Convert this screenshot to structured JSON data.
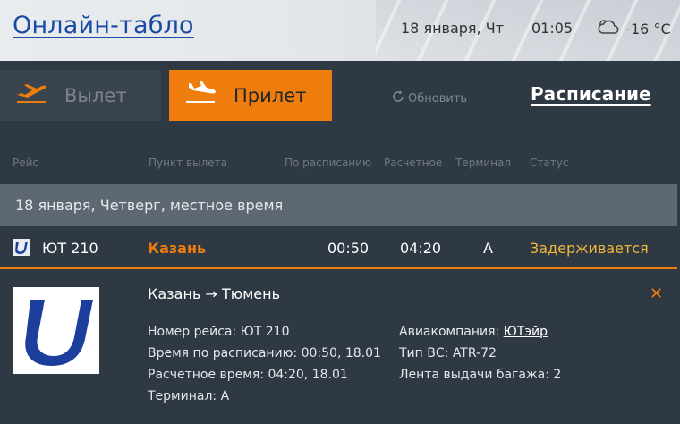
{
  "header": {
    "title": "Онлайн-табло",
    "date": "18 января, Чт",
    "time": "01:05",
    "weather": {
      "icon": "cloud-icon",
      "temperature": "–16 °C"
    }
  },
  "nav": {
    "depart_label": "Вылет",
    "arrive_label": "Прилет",
    "refresh_label": "Обновить",
    "schedule_label": "Расписание",
    "active_tab": "arrive",
    "accent_color": "#ee7d0d"
  },
  "columns": {
    "flight": "Рейс",
    "origin": "Пункт вылета",
    "scheduled": "По расписанию",
    "estimated": "Расчетное",
    "terminal": "Терминал",
    "status": "Статус"
  },
  "date_band": "18 января, Четверг, местное время",
  "flight": {
    "number": "ЮТ 210",
    "city": "Казань",
    "scheduled": "00:50",
    "estimated": "04:20",
    "terminal": "A",
    "status": "Задерживается",
    "status_color": "#f0b63c"
  },
  "details": {
    "route": "Казань → Тюмень",
    "flight_number_label": "Номер рейса:",
    "flight_number": "ЮТ 210",
    "scheduled_label": "Время по расписанию:",
    "scheduled": "00:50, 18.01",
    "estimated_label": "Расчетное время:",
    "estimated": "04:20, 18.01",
    "terminal_label": "Терминал:",
    "terminal": "A",
    "airline_label": "Авиакомпания:",
    "airline": "ЮТэйр",
    "aircraft_label": "Тип ВС:",
    "aircraft": "ATR-72",
    "baggage_label": "Лента выдачи багажа:",
    "baggage": "2"
  }
}
